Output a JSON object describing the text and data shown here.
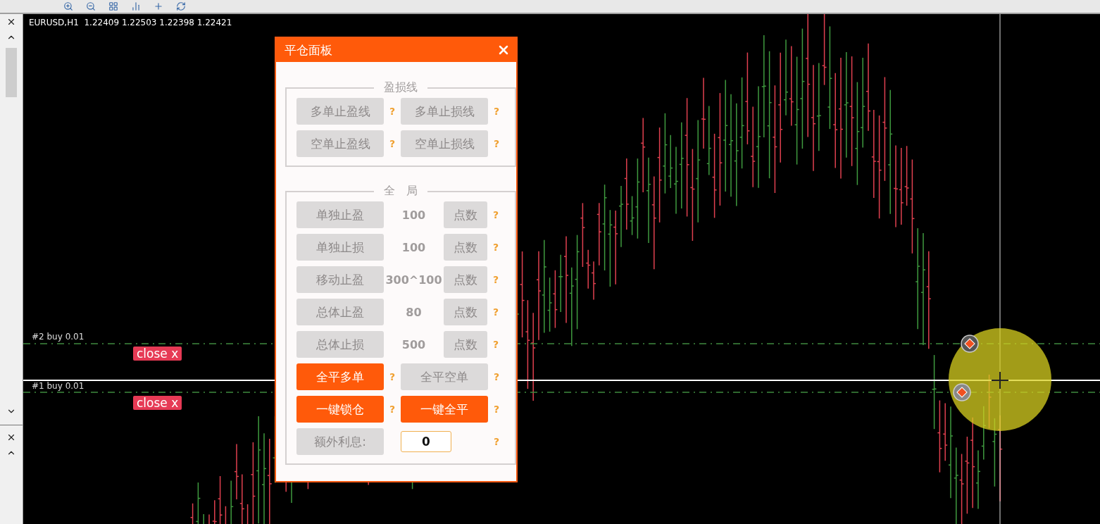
{
  "chart": {
    "symbol_info": "EURUSD,H1  1.22409 1.22503 1.22398 1.22421",
    "orders": [
      {
        "label": "#2 buy 0.01",
        "button": "close x"
      },
      {
        "label": "#1 buy 0.01",
        "button": "close x"
      }
    ]
  },
  "panel": {
    "title": "平仓面板",
    "sections": [
      {
        "title": "盈损线",
        "rows": [
          {
            "kind": "pair",
            "buttons": [
              {
                "label": "多单止盈线",
                "active": false,
                "help": "?"
              },
              {
                "label": "多单止损线",
                "active": false,
                "help": "?"
              }
            ]
          },
          {
            "kind": "pair",
            "buttons": [
              {
                "label": "空单止盈线",
                "active": false,
                "help": "?"
              },
              {
                "label": "空单止损线",
                "active": false,
                "help": "?"
              }
            ]
          }
        ]
      },
      {
        "title": "全　局",
        "rows": [
          {
            "kind": "setting",
            "label": "单独止盈",
            "value": "100",
            "unit": "点数",
            "help": "?"
          },
          {
            "kind": "setting",
            "label": "单独止损",
            "value": "100",
            "unit": "点数",
            "help": "?"
          },
          {
            "kind": "setting",
            "label": "移动止盈",
            "value": "300^100",
            "unit": "点数",
            "help": "?"
          },
          {
            "kind": "setting",
            "label": "总体止盈",
            "value": "80",
            "unit": "点数",
            "help": "?"
          },
          {
            "kind": "setting",
            "label": "总体止损",
            "value": "500",
            "unit": "点数",
            "help": "?"
          },
          {
            "kind": "pair",
            "buttons": [
              {
                "label": "全平多单",
                "active": true,
                "help": "?"
              },
              {
                "label": "全平空单",
                "active": false,
                "help": "?"
              }
            ]
          },
          {
            "kind": "pair",
            "buttons": [
              {
                "label": "一键锁仓",
                "active": true,
                "help": "?"
              },
              {
                "label": "一键全平",
                "active": true,
                "help": "?"
              }
            ]
          },
          {
            "kind": "input",
            "label": "额外利息:",
            "value": "0",
            "help": "?"
          }
        ]
      }
    ]
  }
}
